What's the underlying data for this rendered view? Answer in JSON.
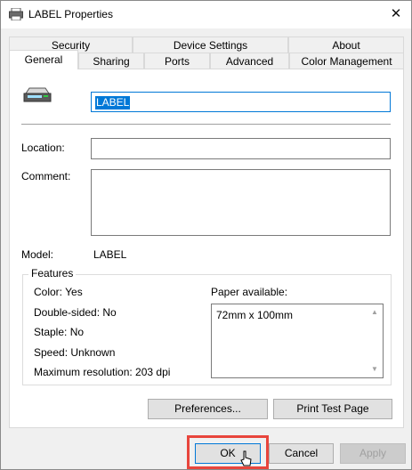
{
  "window": {
    "title": "LABEL Properties",
    "close_glyph": "✕"
  },
  "tabs_row1": [
    "Security",
    "Device Settings",
    "About"
  ],
  "tabs_row2": [
    "General",
    "Sharing",
    "Ports",
    "Advanced",
    "Color Management"
  ],
  "general": {
    "printer_name": "LABEL",
    "location_label": "Location:",
    "location_value": "",
    "comment_label": "Comment:",
    "comment_value": "",
    "model_label": "Model:",
    "model_value": "LABEL"
  },
  "features": {
    "title": "Features",
    "color": "Color: Yes",
    "double_sided": "Double-sided: No",
    "staple": "Staple: No",
    "speed": "Speed: Unknown",
    "max_resolution": "Maximum resolution: 203 dpi",
    "paper_label": "Paper available:",
    "paper_items": [
      "72mm x 100mm"
    ]
  },
  "buttons": {
    "preferences": "Preferences...",
    "print_test_page": "Print Test Page",
    "ok": "OK",
    "cancel": "Cancel",
    "apply": "Apply"
  },
  "colors": {
    "accent": "#0078d7",
    "highlight": "#e8453c"
  }
}
